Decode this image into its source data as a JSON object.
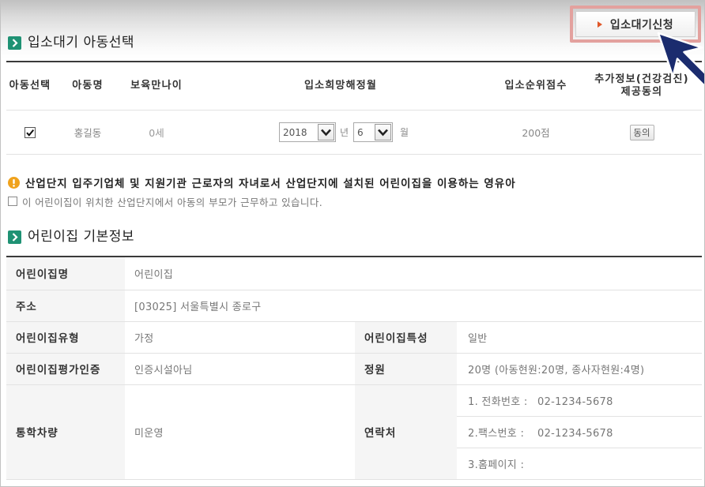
{
  "colors": {
    "accent_green": "#1f9274",
    "warning_orange": "#f0a21c",
    "highlight_pink": "#e3a19e",
    "cursor_navy": "#1b2c6e",
    "button_triangle": "#e0582a"
  },
  "icons": {
    "section_title": "chevron-right-square-icon",
    "notice": "warning-icon",
    "apply_button": "triangle-right-icon",
    "select_toggle": "chevron-down-icon",
    "pointer": "mouse-cursor-icon"
  },
  "apply_button": {
    "label": "입소대기신청"
  },
  "child_selection": {
    "title": "입소대기 아동선택",
    "columns": {
      "select": "아동선택",
      "name": "아동명",
      "age": "보육만나이",
      "desired_month": "입소희망해정월",
      "priority_score": "입소순위점수",
      "consent_line1": "추가정보(건강검진)",
      "consent_line2": "제공동의"
    },
    "rows": [
      {
        "selected": true,
        "name": "홍길동",
        "age": "0세",
        "year": "2018",
        "year_unit": "년",
        "month": "6",
        "month_unit": "월",
        "priority_score": "200점",
        "consent_button": "동의"
      }
    ]
  },
  "industrial_complex": {
    "notice": "산업단지 입주기업체 및 지원기관 근로자의 자녀로서 산업단지에 설치된 어린이집을 이용하는 영유아",
    "checkbox_label": "이 어린이집이 위치한 산업단지에서 아동의 부모가 근무하고 있습니다.",
    "checked": false
  },
  "center_info": {
    "title": "어린이집 기본정보",
    "name_label": "어린이집명",
    "name": "어린이집",
    "address_label": "주소",
    "address": "[03025] 서울특별시 종로구",
    "type_label": "어린이집유형",
    "type": "가정",
    "feature_label": "어린이집특성",
    "feature": "일반",
    "accreditation_label": "어린이집평가인증",
    "accreditation": "인증시설아님",
    "capacity_label": "정원",
    "capacity": "20명 (아동현원:20명, 종사자현원:4명)",
    "shuttle_label": "통학차량",
    "shuttle": "미운영",
    "contact_label": "연락처",
    "contacts": [
      {
        "label": "1. 전화번호 :",
        "value": "02-1234-5678"
      },
      {
        "label": "2.팩스번호 :",
        "value": "02-1234-5678"
      },
      {
        "label": "3.홈페이지 :"
      }
    ]
  }
}
